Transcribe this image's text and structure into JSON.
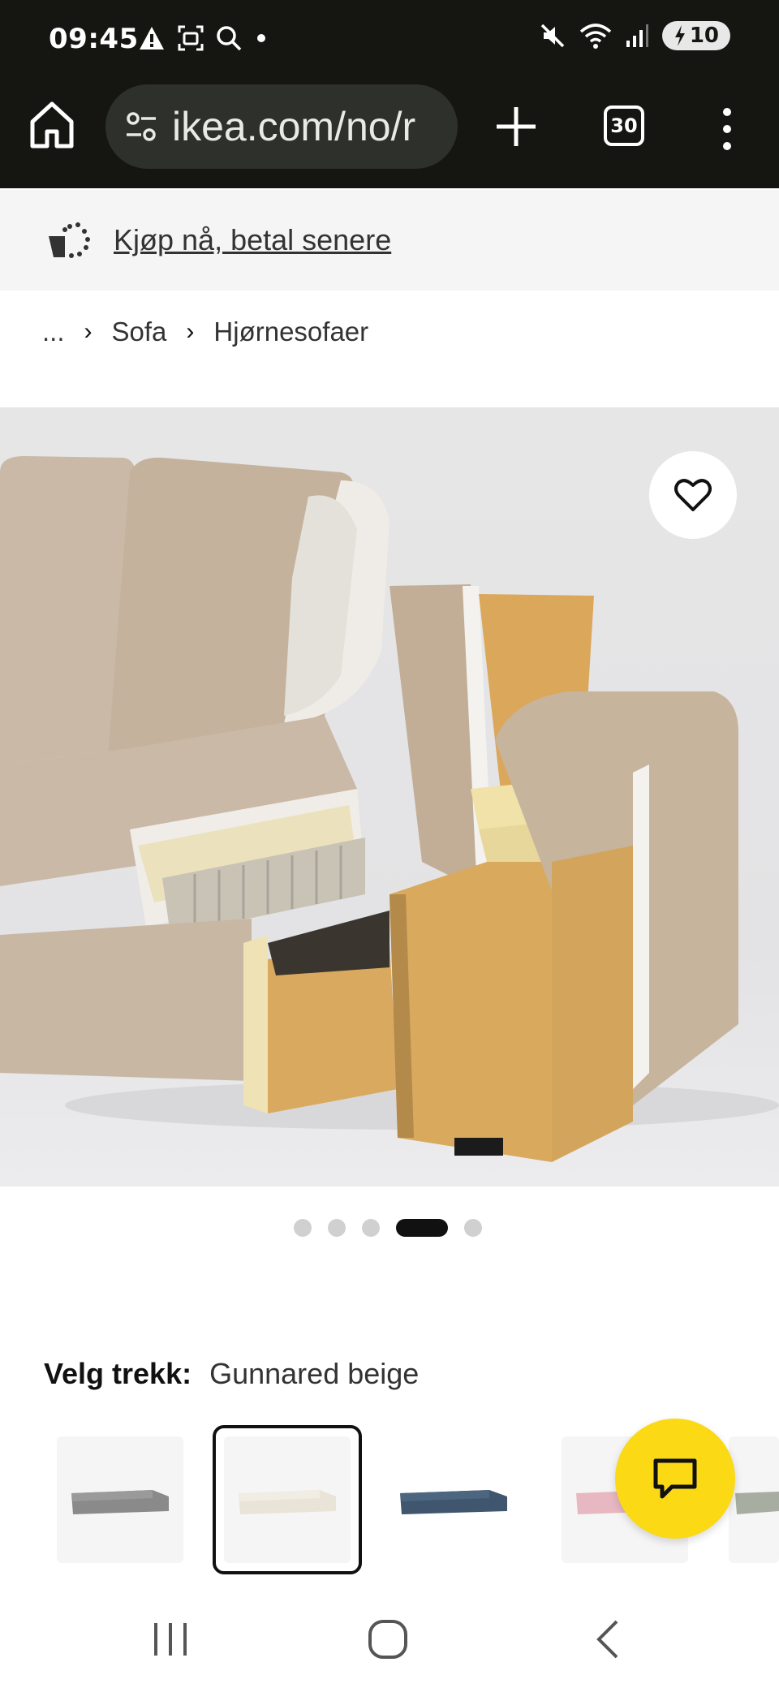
{
  "status_bar": {
    "time": "09:45",
    "battery": "10",
    "icons_left": [
      "alert-icon",
      "screenshot-icon",
      "search-icon",
      "dot-icon"
    ],
    "icons_right": [
      "mute-icon",
      "wifi-icon",
      "signal-icon",
      "battery-icon"
    ]
  },
  "browser": {
    "url": "ikea.com/no/r",
    "tab_count": "30",
    "icons": [
      "home-icon",
      "site-settings-icon",
      "plus-icon",
      "tabs-icon",
      "more-vert-icon"
    ]
  },
  "promo": {
    "link_text": "Kjøp nå, betal senere",
    "icon": "cart-dots-icon"
  },
  "breadcrumb": {
    "ellipsis": "...",
    "items": [
      "Sofa",
      "Hjørnesofaer"
    ]
  },
  "gallery": {
    "image": "sofa-cross-section",
    "slide_count": 5,
    "active_slide": 4
  },
  "cover": {
    "label": "Velg trekk:",
    "value": "Gunnared beige",
    "options": [
      {
        "name": "grey",
        "color": "#8a8a8a"
      },
      {
        "name": "beige",
        "color": "#e9e3d8",
        "selected": true
      },
      {
        "name": "blue",
        "color": "#3f566e"
      },
      {
        "name": "pink",
        "color": "#e8b8c2"
      },
      {
        "name": "green-grey",
        "color": "#a8ada2"
      }
    ]
  },
  "colors": {
    "browser_bg": "#151611",
    "chat_yellow": "#fbd914",
    "promo_bg": "#f5f5f5"
  },
  "nav": {
    "icons": [
      "recents-icon",
      "home-circle-icon",
      "back-icon"
    ]
  }
}
